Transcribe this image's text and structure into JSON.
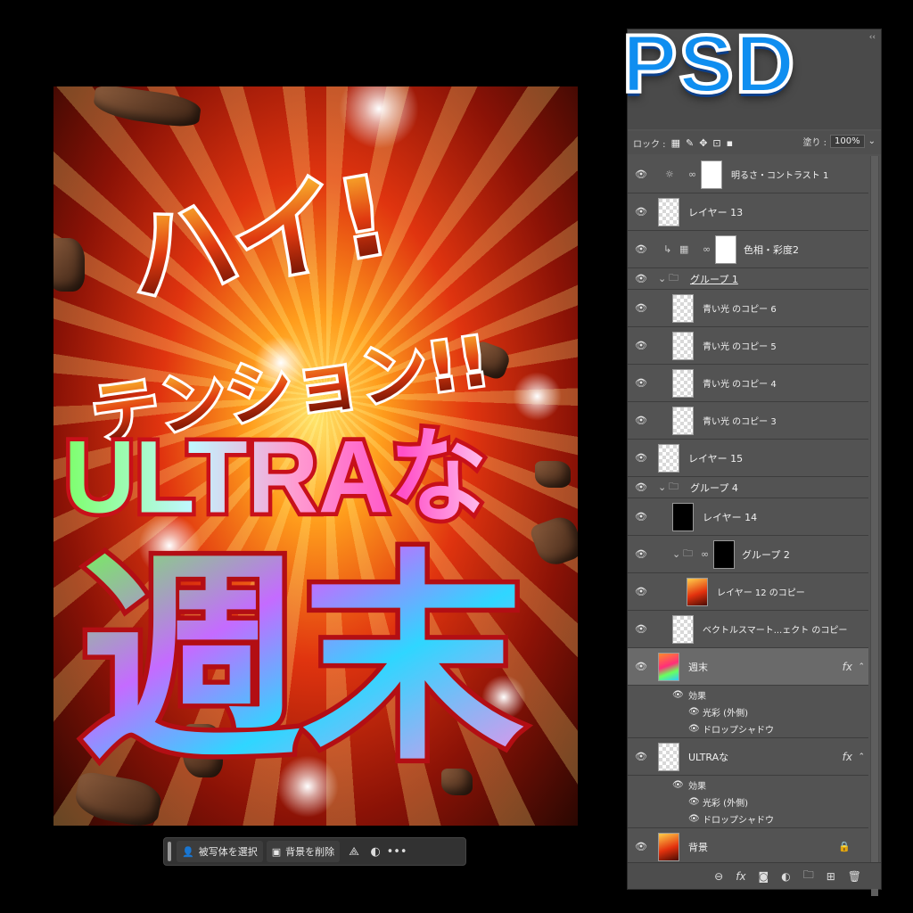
{
  "badge": "PSD",
  "canvas": {
    "headline_line1": "ハイ!",
    "headline_line2": "テンション!!",
    "title_line1": "ULTRAな",
    "title_line2": "週末"
  },
  "taskbar": {
    "select_subject": "被写体を選択",
    "remove_background": "背景を削除",
    "more": "•••"
  },
  "layers_panel": {
    "lock_label": "ロック :",
    "fill_label": "塗り :",
    "fill_value": "100%",
    "layers": [
      {
        "name": "明るさ・コントラスト 1"
      },
      {
        "name": "レイヤー 13"
      },
      {
        "name": "色相・彩度2"
      },
      {
        "name": "グループ 1"
      },
      {
        "name": "青い光 のコピー 6"
      },
      {
        "name": "青い光 のコピー 5"
      },
      {
        "name": "青い光 のコピー 4"
      },
      {
        "name": "青い光 のコピー 3"
      },
      {
        "name": "レイヤー 15"
      },
      {
        "name": "グループ 4"
      },
      {
        "name": "レイヤー 14"
      },
      {
        "name": "グループ 2"
      },
      {
        "name": "レイヤー 12 のコピー"
      },
      {
        "name": "ベクトルスマート...ェクト のコピー"
      },
      {
        "name": "週末"
      },
      {
        "name": "ULTRAな"
      },
      {
        "name": "背景"
      }
    ],
    "effects": {
      "label": "効果",
      "outer_glow": "光彩 (外側)",
      "drop_shadow": "ドロップシャドウ"
    },
    "fx": "fx"
  }
}
